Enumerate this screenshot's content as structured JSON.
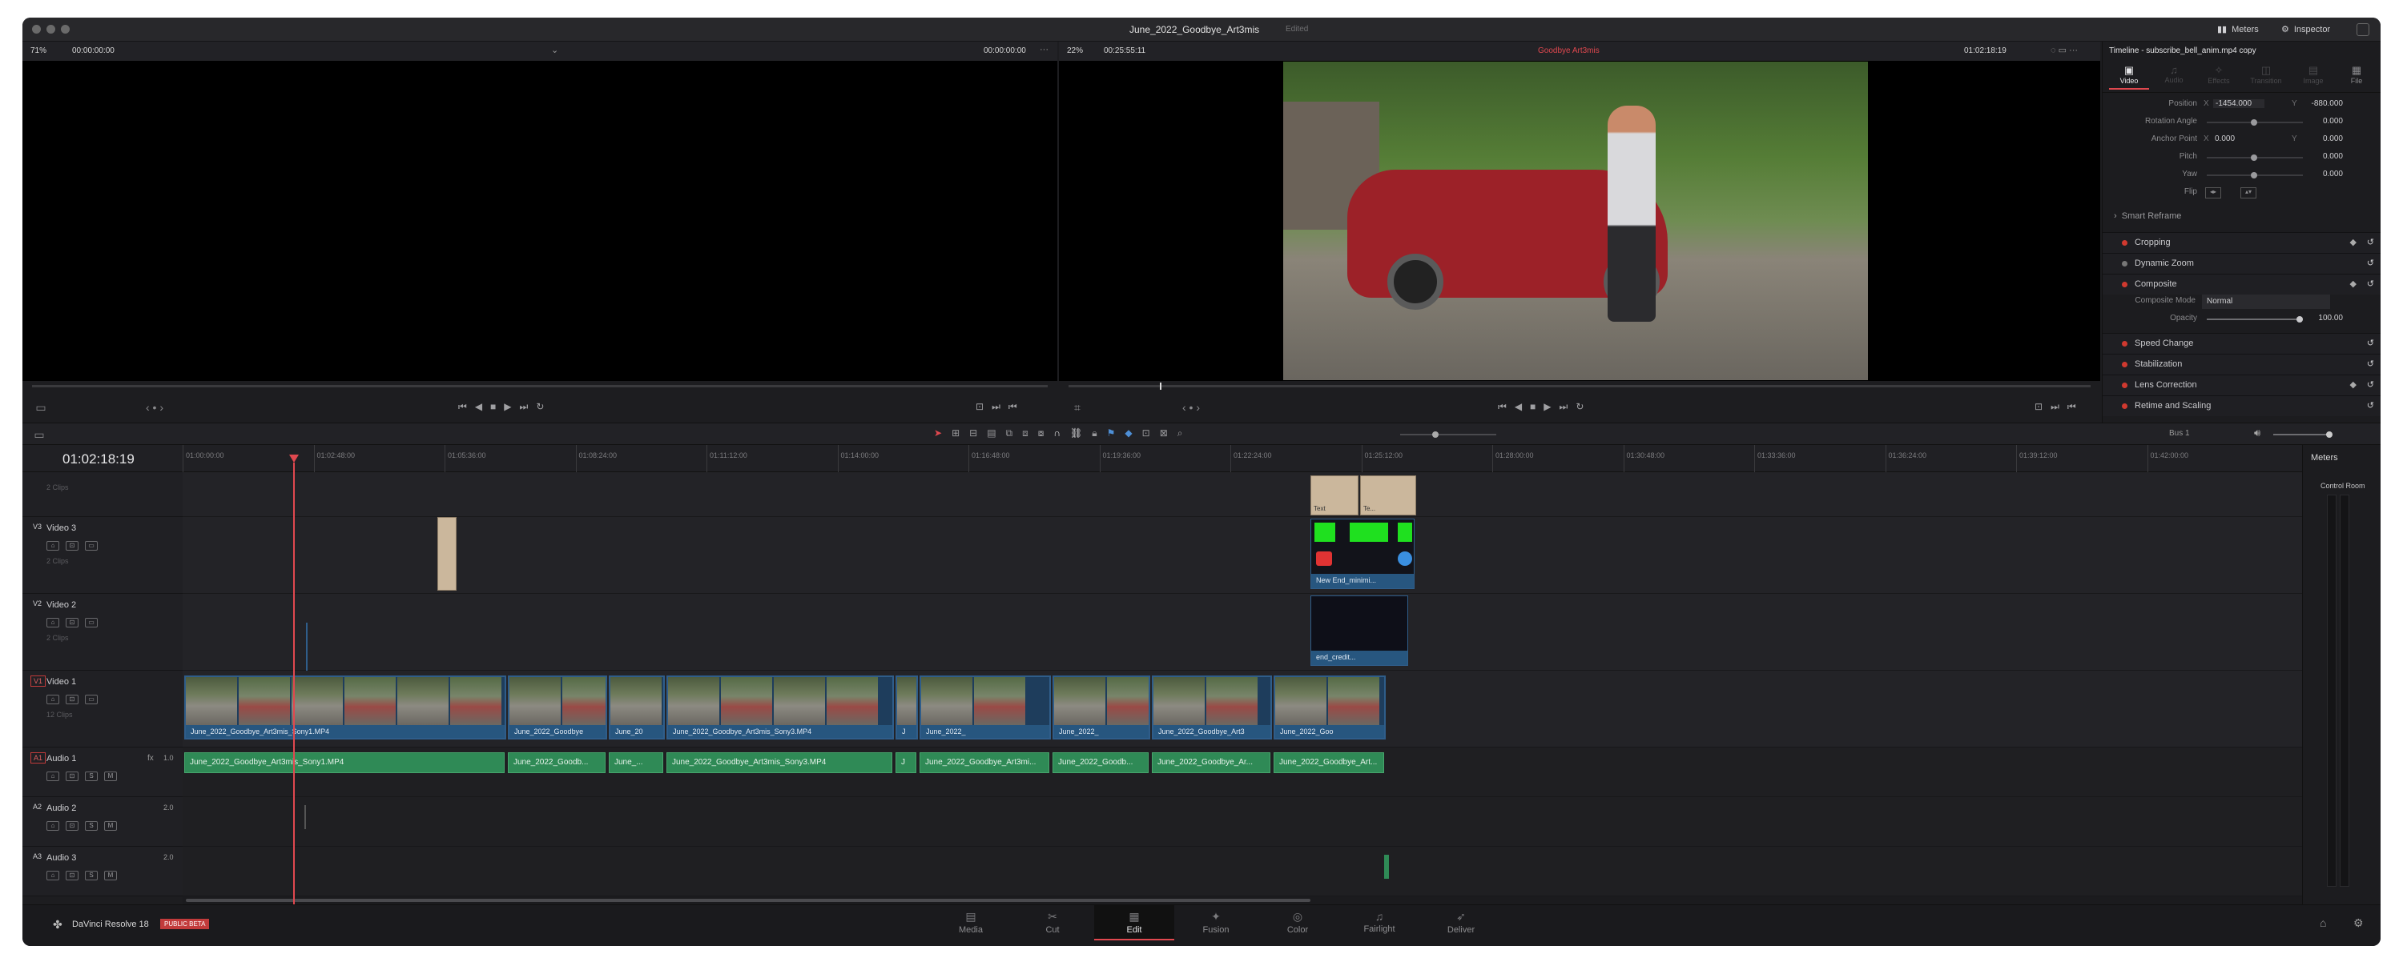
{
  "window": {
    "title": "June_2022_Goodbye_Art3mis",
    "status": "Edited",
    "meters_label": "Meters",
    "inspector_label": "Inspector"
  },
  "source_viewer": {
    "zoom": "71%",
    "timecode_left": "00:00:00:00",
    "timecode_right": "00:00:00:00"
  },
  "timeline_viewer": {
    "zoom": "22%",
    "duration": "00:25:55:11",
    "timeline_name": "Goodbye Art3mis",
    "timecode": "01:02:18:19"
  },
  "inspector": {
    "title": "Timeline - subscribe_bell_anim.mp4 copy",
    "tabs": [
      "Video",
      "Audio",
      "Effects",
      "Transition",
      "Image",
      "File"
    ],
    "transform": {
      "position_label": "Position",
      "position_x": "-1454.000",
      "position_y": "-880.000",
      "rotation_label": "Rotation Angle",
      "rotation": "0.000",
      "anchor_label": "Anchor Point",
      "anchor_x": "0.000",
      "anchor_y": "0.000",
      "pitch_label": "Pitch",
      "pitch": "0.000",
      "yaw_label": "Yaw",
      "yaw": "0.000",
      "flip_label": "Flip"
    },
    "smart_reframe": "Smart Reframe",
    "cropping": "Cropping",
    "dynamic_zoom": "Dynamic Zoom",
    "composite": "Composite",
    "composite_mode_label": "Composite Mode",
    "composite_mode": "Normal",
    "opacity_label": "Opacity",
    "opacity": "100.00",
    "speed_change": "Speed Change",
    "stabilization": "Stabilization",
    "lens_correction": "Lens Correction",
    "retime_scaling": "Retime and Scaling"
  },
  "timeline": {
    "timecode": "01:02:18:19",
    "ruler": [
      "01:00:00:00",
      "01:02:48:00",
      "01:05:36:00",
      "01:08:24:00",
      "01:11:12:00",
      "01:14:00:00",
      "01:16:48:00",
      "01:19:36:00",
      "01:22:24:00",
      "01:25:12:00",
      "01:28:00:00",
      "01:30:48:00",
      "01:33:36:00",
      "01:36:24:00",
      "01:39:12:00",
      "01:42:00:00"
    ],
    "audio_bus": "Bus 1",
    "tracks": {
      "top_clips": "2 Clips",
      "v3": {
        "id": "V3",
        "name": "Video 3",
        "clips": "2 Clips"
      },
      "v2": {
        "id": "V2",
        "name": "Video 2",
        "clips": "2 Clips"
      },
      "v1": {
        "id": "V1",
        "name": "Video 1",
        "clips": "12 Clips"
      },
      "a1": {
        "id": "A1",
        "name": "Audio 1",
        "fx": "fx",
        "level": "1.0"
      },
      "a2": {
        "id": "A2",
        "name": "Audio 2",
        "level": "2.0"
      },
      "a3": {
        "id": "A3",
        "name": "Audio 3",
        "level": "2.0"
      }
    },
    "v1_clips": [
      "June_2022_Goodbye_Art3mis_Sony1.MP4",
      "June_2022_Goodbye",
      "June_20",
      "June_2022_Goodbye_Art3mis_Sony3.MP4",
      "J",
      "June_2022_",
      "June_2022_",
      "June_2022_Goodbye_Art3",
      "June_2022_Goo"
    ],
    "a1_clips": [
      "June_2022_Goodbye_Art3mis_Sony1.MP4",
      "June_2022_Goodb...",
      "June_...",
      "June_2022_Goodbye_Art3mis_Sony3.MP4",
      "J",
      "June_2022_Goodbye_Art3mi...",
      "June_2022_Goodb...",
      "June_2022_Goodbye_Ar...",
      "June_2022_Goodbye_Art..."
    ],
    "title_clips": [
      "Text",
      "Te..."
    ],
    "end_clip": "New End_minimi...",
    "credits_clip": "end_credit..."
  },
  "meters": {
    "title": "Meters",
    "control_room": "Control Room"
  },
  "footer": {
    "app": "DaVinci Resolve 18",
    "badge": "PUBLIC BETA",
    "pages": [
      "Media",
      "Cut",
      "Edit",
      "Fusion",
      "Color",
      "Fairlight",
      "Deliver"
    ],
    "active": "Edit"
  },
  "colors": {
    "accent_red": "#e0484f",
    "clip_blue": "#27567f",
    "audio_green": "#2f8a56",
    "bg": "#1d1d20"
  }
}
